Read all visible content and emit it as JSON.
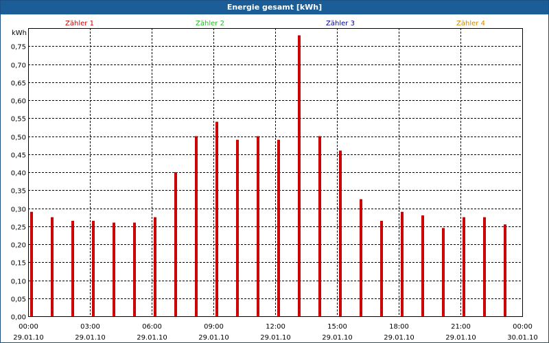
{
  "window": {
    "title": "Energie gesamt [kWh]"
  },
  "chart_data": {
    "type": "bar",
    "title": "Energie gesamt [kWh]",
    "ylabel": "kWh",
    "xlabel": "",
    "ylim": [
      0,
      0.8
    ],
    "grid": true,
    "legend": {
      "placement": "top",
      "entries": [
        {
          "name": "Zähler 1",
          "color": "#cc0000"
        },
        {
          "name": "Zähler 2",
          "color": "#22bb22"
        },
        {
          "name": "Zähler 3",
          "color": "#000099"
        },
        {
          "name": "Zähler 4",
          "color": "#cc8800"
        }
      ]
    },
    "yticks": [
      "0,00",
      "0,05",
      "0,10",
      "0,15",
      "0,20",
      "0,25",
      "0,30",
      "0,35",
      "0,40",
      "0,45",
      "0,50",
      "0,55",
      "0,60",
      "0,65",
      "0,70",
      "0,75"
    ],
    "xticks": [
      {
        "time": "00:00",
        "date": "29.01.10"
      },
      {
        "time": "03:00",
        "date": "29.01.10"
      },
      {
        "time": "06:00",
        "date": "29.01.10"
      },
      {
        "time": "09:00",
        "date": "29.01.10"
      },
      {
        "time": "12:00",
        "date": "29.01.10"
      },
      {
        "time": "15:00",
        "date": "29.01.10"
      },
      {
        "time": "18:00",
        "date": "29.01.10"
      },
      {
        "time": "21:00",
        "date": "29.01.10"
      },
      {
        "time": "00:00",
        "date": "30.01.10"
      }
    ],
    "series": [
      {
        "name": "Zähler 1",
        "color": "#cc0000",
        "hours": [
          0,
          1,
          2,
          3,
          4,
          5,
          6,
          7,
          8,
          9,
          10,
          11,
          12,
          13,
          14,
          15,
          16,
          17,
          18,
          19,
          20,
          21,
          22,
          23
        ],
        "values": [
          0.29,
          0.275,
          0.265,
          0.265,
          0.26,
          0.26,
          0.275,
          0.4,
          0.5,
          0.54,
          0.49,
          0.5,
          0.49,
          0.78,
          0.5,
          0.46,
          0.325,
          0.265,
          0.29,
          0.28,
          0.245,
          0.275,
          0.275,
          0.255
        ]
      }
    ]
  }
}
